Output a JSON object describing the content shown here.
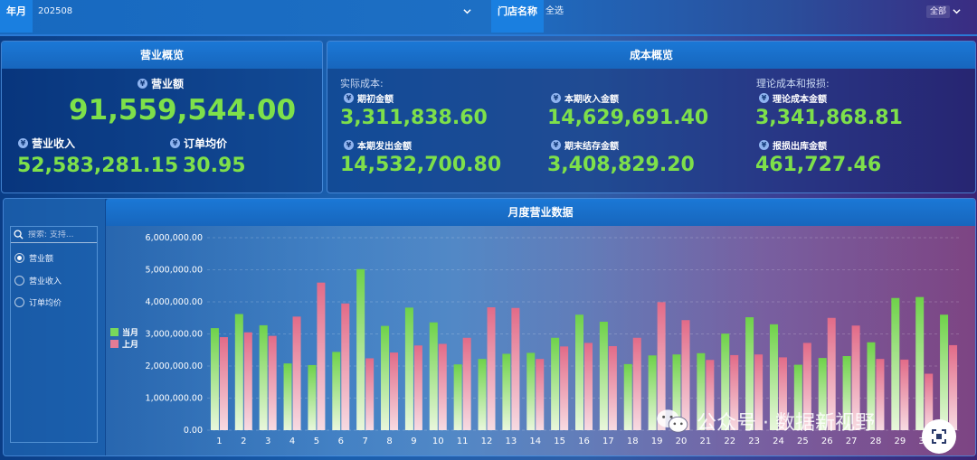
{
  "filters": {
    "month_label": "年月",
    "month_value": "202508",
    "store_label": "门店名称",
    "store_value": "全选",
    "store_badge": "全部"
  },
  "business": {
    "title": "营业概览",
    "revenue_label": "营业额",
    "revenue_value": "91,559,544.00",
    "income_label": "营业收入",
    "income_value": "52,583,281.15",
    "avg_label": "订单均价",
    "avg_value": "30.95"
  },
  "cost": {
    "title": "成本概览",
    "actual_group": "实际成本:",
    "theory_group": "理论成本和报损:",
    "items": [
      {
        "label": "期初金额",
        "value": "3,311,838.60"
      },
      {
        "label": "本期收入金额",
        "value": "14,629,691.40"
      },
      {
        "label": "理论成本金额",
        "value": "3,341,868.81"
      },
      {
        "label": "本期发出金额",
        "value": "14,532,700.80"
      },
      {
        "label": "期末结存金额",
        "value": "3,408,829.20"
      },
      {
        "label": "报损出库金额",
        "value": "461,727.46"
      }
    ]
  },
  "monthly": {
    "title": "月度营业数据",
    "search_placeholder": "搜索: 支持...",
    "options": [
      {
        "label": "营业额",
        "checked": true
      },
      {
        "label": "营业收入",
        "checked": false
      },
      {
        "label": "订单均价",
        "checked": false
      }
    ]
  },
  "colors": {
    "current": "#79d95b",
    "previous": "#e47c95",
    "kpi": "#7ee04a"
  },
  "chart_data": {
    "type": "bar",
    "ylim": [
      0,
      6000000
    ],
    "yticks": [
      "0.00",
      "1,000,000.00",
      "2,000,000.00",
      "3,000,000.00",
      "4,000,000.00",
      "5,000,000.00",
      "6,000,000.00"
    ],
    "categories": [
      "1",
      "2",
      "3",
      "4",
      "5",
      "6",
      "7",
      "8",
      "9",
      "10",
      "11",
      "12",
      "13",
      "14",
      "15",
      "16",
      "17",
      "18",
      "19",
      "20",
      "21",
      "22",
      "23",
      "24",
      "25",
      "26",
      "27",
      "28",
      "29",
      "30",
      "31"
    ],
    "series": [
      {
        "name": "当月",
        "values": [
          3180000,
          3620000,
          3270000,
          2080000,
          2030000,
          2440000,
          5020000,
          3250000,
          3820000,
          3360000,
          2050000,
          2220000,
          2380000,
          2410000,
          2880000,
          3600000,
          3380000,
          2060000,
          2330000,
          2360000,
          2400000,
          3010000,
          3520000,
          3300000,
          2040000,
          2250000,
          2310000,
          2740000,
          4120000,
          4150000,
          3600000
        ]
      },
      {
        "name": "上月",
        "values": [
          2900000,
          3050000,
          2940000,
          3540000,
          4600000,
          3950000,
          2240000,
          2420000,
          2640000,
          2690000,
          2880000,
          3830000,
          3810000,
          2220000,
          2610000,
          2720000,
          2620000,
          2880000,
          3990000,
          3430000,
          2190000,
          2340000,
          2360000,
          2270000,
          2720000,
          3500000,
          3260000,
          2220000,
          2200000,
          1760000,
          2650000
        ]
      }
    ]
  },
  "watermark": {
    "text": "公众号 · 数据新视野"
  }
}
